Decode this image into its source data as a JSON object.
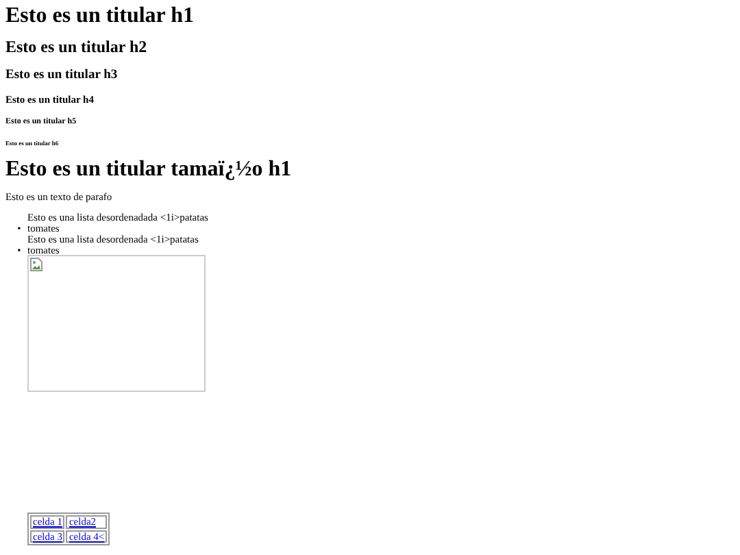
{
  "headings": [
    {
      "kind": "h1",
      "text": "Esto es un titular h1"
    },
    {
      "kind": "h2",
      "text": "Esto es un titular h2"
    },
    {
      "kind": "h3",
      "text": "Esto es un titular h3"
    },
    {
      "kind": "h4",
      "text": "Esto es un titular h4"
    },
    {
      "kind": "h5",
      "text": "Esto es un titular h5"
    },
    {
      "kind": "h6",
      "text": "Esto es un titular h6"
    },
    {
      "kind": "h1",
      "text": "Esto es un titular tamaï¿½o h1"
    }
  ],
  "paragraph": "Esto es un texto de parafo",
  "list": [
    {
      "kind": "plain",
      "text": "Esto es una lista desordenadada <1i>patatas"
    },
    {
      "kind": "bullet",
      "marker": "•",
      "text": "tomates"
    },
    {
      "kind": "plain",
      "text": "Esto es una lista desordenada <1i>patatas"
    },
    {
      "kind": "bullet",
      "marker": "•",
      "text": "tomates"
    }
  ],
  "image": {
    "kind": "broken"
  },
  "table": {
    "rows": [
      [
        "celda 1",
        "celda2"
      ],
      [
        "celda 3",
        "celda 4<"
      ]
    ]
  }
}
